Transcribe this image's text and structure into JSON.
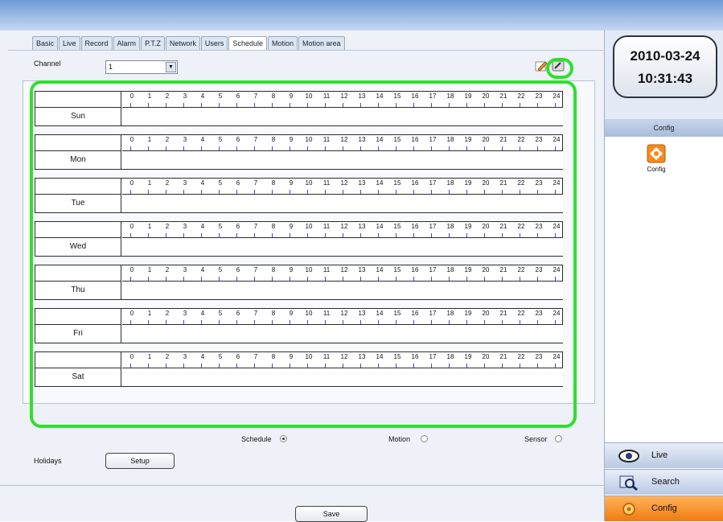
{
  "tabs": [
    "Basic",
    "Live",
    "Record",
    "Alarm",
    "P.T.Z",
    "Network",
    "Users",
    "Schedule",
    "Motion",
    "Motion area"
  ],
  "active_tab": "Schedule",
  "channel": {
    "label": "Channel",
    "value": "1"
  },
  "schedule": {
    "hours": [
      "0",
      "1",
      "2",
      "3",
      "4",
      "5",
      "6",
      "7",
      "8",
      "9",
      "10",
      "11",
      "12",
      "13",
      "14",
      "15",
      "16",
      "17",
      "18",
      "19",
      "20",
      "21",
      "22",
      "23",
      "24"
    ],
    "days": [
      "Sun",
      "Mon",
      "Tue",
      "Wed",
      "Thu",
      "Fri",
      "Sat"
    ]
  },
  "modes": {
    "schedule": "Schedule",
    "motion": "Motion",
    "sensor": "Sensor",
    "selected": "Schedule"
  },
  "holidays": {
    "label": "Holidays",
    "button": "Setup"
  },
  "save_label": "Save",
  "clock": {
    "date": "2010-03-24",
    "time": "10:31:43"
  },
  "side": {
    "header": "Config",
    "icon_label": "Config"
  },
  "nav": [
    {
      "label": "Live",
      "icon": "eye-icon"
    },
    {
      "label": "Search",
      "icon": "search-icon"
    },
    {
      "label": "Config",
      "icon": "config-icon"
    }
  ],
  "colors": {
    "highlight": "#2ee02e",
    "active_nav": "#f07b10",
    "tick": "#3a4fc8"
  }
}
